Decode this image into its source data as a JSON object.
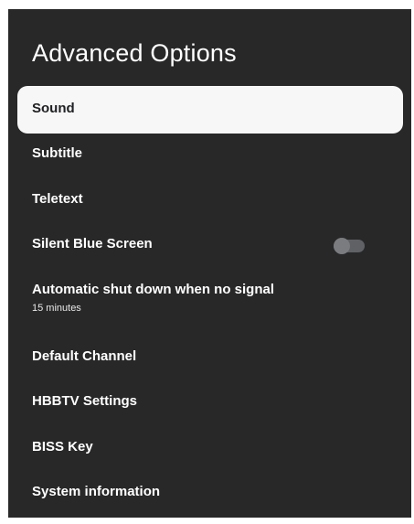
{
  "panel": {
    "title": "Advanced Options"
  },
  "menu": {
    "items": [
      {
        "label": "Sound",
        "selected": true
      },
      {
        "label": "Subtitle"
      },
      {
        "label": "Teletext"
      },
      {
        "label": "Silent Blue Screen",
        "toggle": "off"
      },
      {
        "label": "Automatic shut down when no signal",
        "value": "15 minutes"
      },
      {
        "label": "Default Channel"
      },
      {
        "label": "HBBTV Settings"
      },
      {
        "label": "BISS Key"
      },
      {
        "label": "System information"
      }
    ]
  },
  "colors": {
    "panel_background": "#282829",
    "selected_background": "#f7f7f7",
    "toggle_track_off": "#5f6164",
    "toggle_knob_off": "#7a7c80"
  }
}
